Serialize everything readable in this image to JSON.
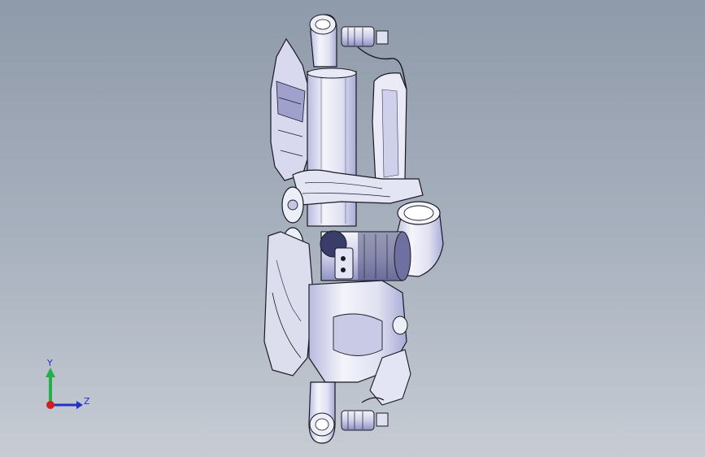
{
  "viewport": {
    "background_top": "#8f9aaa",
    "background_bottom": "#c7ccd4",
    "model_fill": "#f2f2fa",
    "model_shade": "#c9cbe6",
    "model_line": "#1a1a22"
  },
  "triad": {
    "y_label": "Y",
    "z_label": "Z",
    "y_color": "#22b04a",
    "z_color": "#2230c8",
    "x_color": "#d21e1e"
  }
}
